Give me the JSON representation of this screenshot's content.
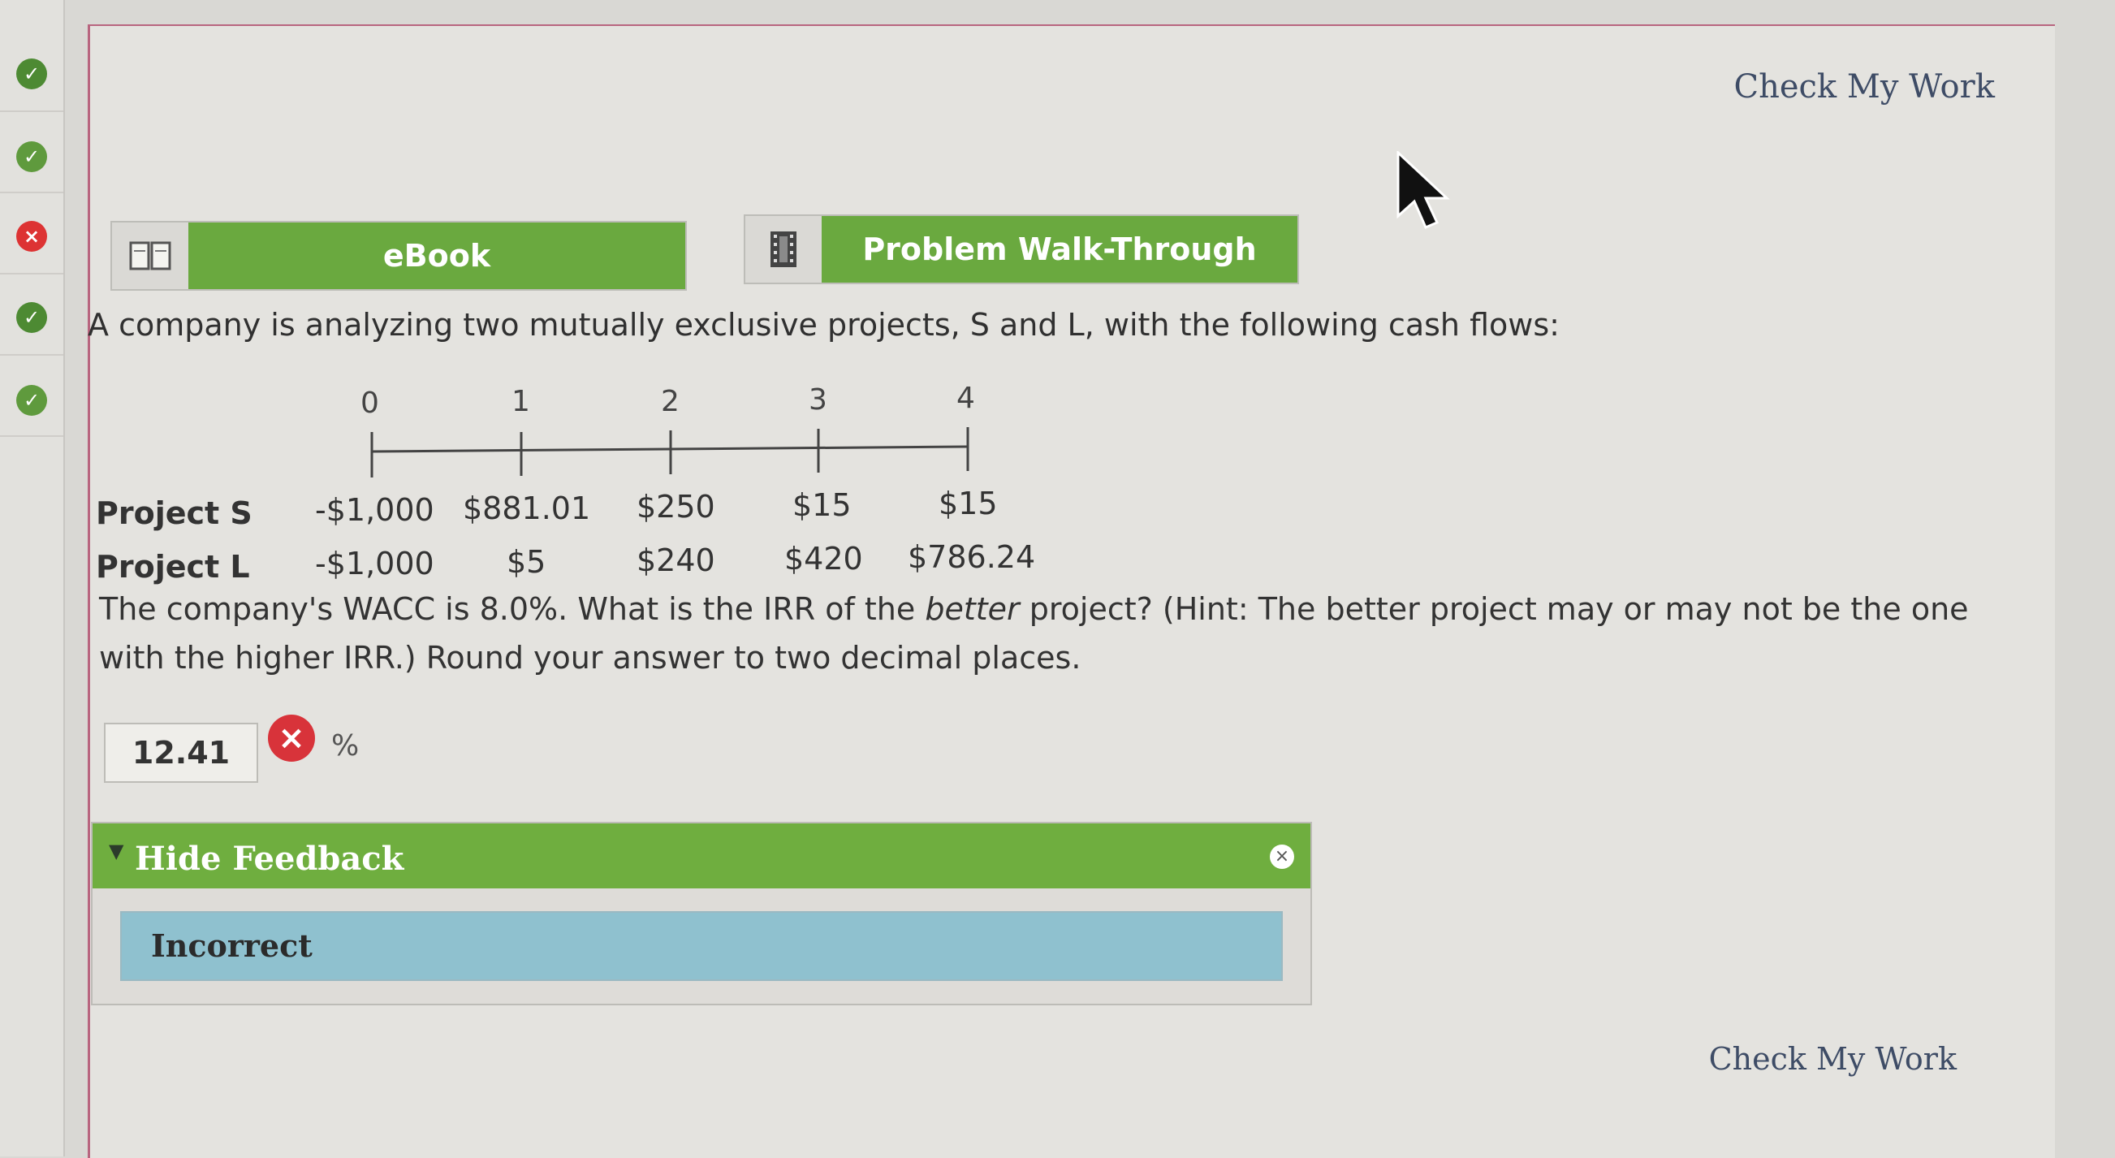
{
  "header": {
    "check_top": "Check My Work",
    "check_bottom": "Check My Work"
  },
  "sidebar": {
    "items": [
      {
        "state": "partial",
        "icon": "half-check-icon"
      },
      {
        "state": "correct",
        "icon": "check-icon"
      },
      {
        "state": "incorrect",
        "icon": "x-icon"
      },
      {
        "state": "partial",
        "icon": "half-check-icon"
      },
      {
        "state": "correct",
        "icon": "check-icon"
      }
    ]
  },
  "tools": {
    "ebook_label": "eBook",
    "walkthrough_label": "Problem Walk-Through"
  },
  "question": {
    "intro": "A company is analyzing two mutually exclusive projects, S and L, with the following cash flows:",
    "timeline": [
      "0",
      "1",
      "2",
      "3",
      "4"
    ],
    "project_s": {
      "label": "Project S",
      "flows": [
        "-$1,000",
        "$881.01",
        "$250",
        "$15",
        "$15"
      ]
    },
    "project_l": {
      "label": "Project L",
      "flows": [
        "-$1,000",
        "$5",
        "$240",
        "$420",
        "$786.24"
      ]
    },
    "prompt_1": "The company's WACC is 8.0%. What is the IRR of the ",
    "prompt_em": "better",
    "prompt_2": " project? (Hint: The better project may or may not be the one with the higher IRR.) Round your answer to two decimal places."
  },
  "answer": {
    "value": "12.41",
    "unit": "%"
  },
  "feedback": {
    "toggle_label": "Hide Feedback",
    "status": "Incorrect"
  },
  "colors": {
    "accent_green": "#6aa93f",
    "feedback_blue": "#8fc1cf",
    "error_red": "#d8333a"
  }
}
